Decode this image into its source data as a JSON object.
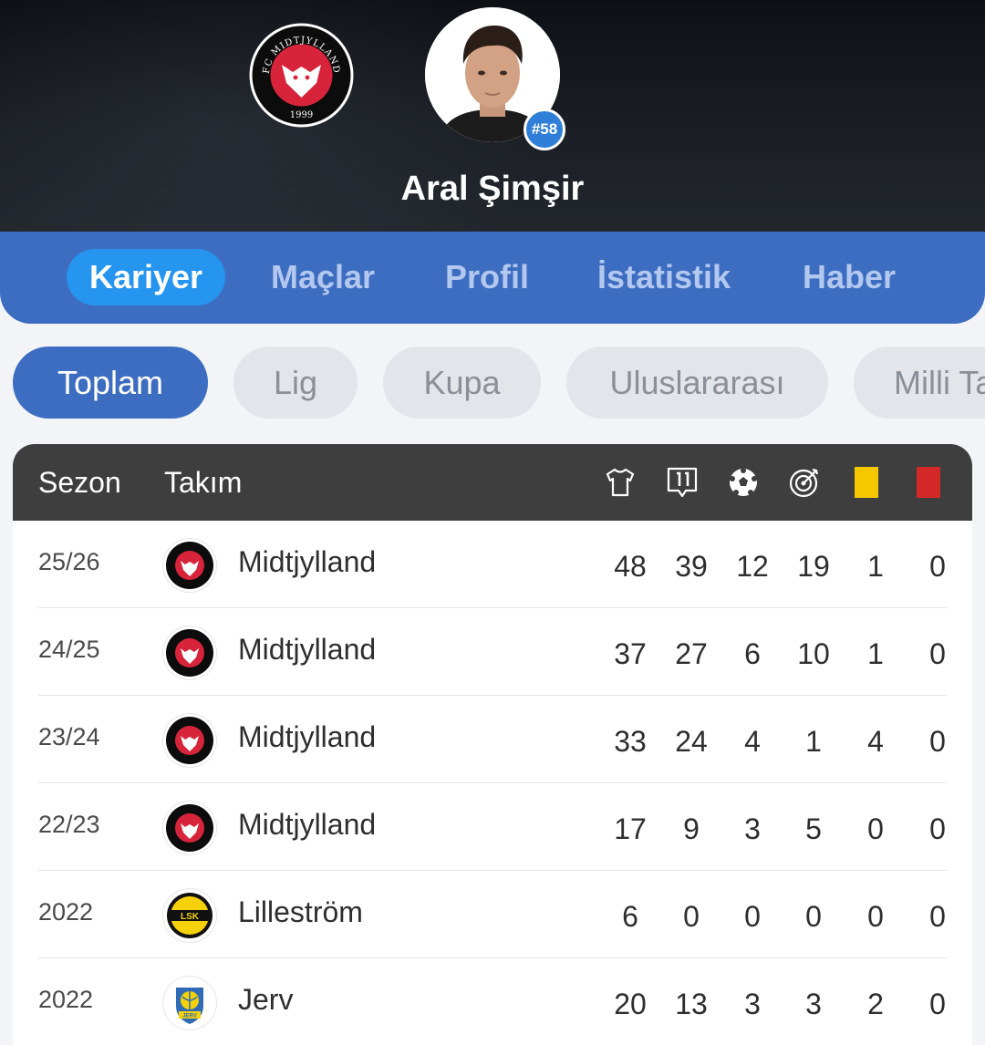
{
  "player": {
    "name": "Aral Şimşir",
    "number": "#58",
    "club": "FC Midtjylland"
  },
  "club_logo": {
    "top_text": "FC MIDTJYLLAND",
    "year": "1999"
  },
  "tabs": [
    {
      "label": "Kariyer",
      "active": true
    },
    {
      "label": "Maçlar",
      "active": false
    },
    {
      "label": "Profil",
      "active": false
    },
    {
      "label": "İstatistik",
      "active": false
    },
    {
      "label": "Haber",
      "active": false
    }
  ],
  "filters": [
    {
      "label": "Toplam",
      "active": true
    },
    {
      "label": "Lig",
      "active": false
    },
    {
      "label": "Kupa",
      "active": false
    },
    {
      "label": "Uluslararası",
      "active": false
    },
    {
      "label": "Milli Takım",
      "active": false
    }
  ],
  "table": {
    "headers": {
      "season": "Sezon",
      "team": "Takım",
      "icons": [
        "shirt-icon",
        "lineup-eleven-icon",
        "football-icon",
        "target-icon",
        "yellow-card-icon",
        "red-card-icon"
      ]
    },
    "rows": [
      {
        "season": "25/26",
        "team": "Midtjylland",
        "logo": "midtjylland",
        "stats": [
          "48",
          "39",
          "12",
          "19",
          "1",
          "0"
        ]
      },
      {
        "season": "24/25",
        "team": "Midtjylland",
        "logo": "midtjylland",
        "stats": [
          "37",
          "27",
          "6",
          "10",
          "1",
          "0"
        ]
      },
      {
        "season": "23/24",
        "team": "Midtjylland",
        "logo": "midtjylland",
        "stats": [
          "33",
          "24",
          "4",
          "1",
          "4",
          "0"
        ]
      },
      {
        "season": "22/23",
        "team": "Midtjylland",
        "logo": "midtjylland",
        "stats": [
          "17",
          "9",
          "3",
          "5",
          "0",
          "0"
        ]
      },
      {
        "season": "2022",
        "team": "Lilleström",
        "logo": "lillestrom",
        "stats": [
          "6",
          "0",
          "0",
          "0",
          "0",
          "0"
        ]
      },
      {
        "season": "2022",
        "team": "Jerv",
        "logo": "jerv",
        "stats": [
          "20",
          "13",
          "3",
          "3",
          "2",
          "0"
        ]
      }
    ]
  },
  "logo_text": {
    "lillestrom": "LSK",
    "jerv": "JERV"
  },
  "colors": {
    "tab_bar": "#3d6dc0",
    "tab_active": "#2595ef",
    "badge": "#2f7fd8",
    "midtjylland_red": "#d8243b",
    "lillestrom_yellow": "#f5d10a",
    "yellow_card": "#f5c800",
    "red_card": "#d52828"
  }
}
